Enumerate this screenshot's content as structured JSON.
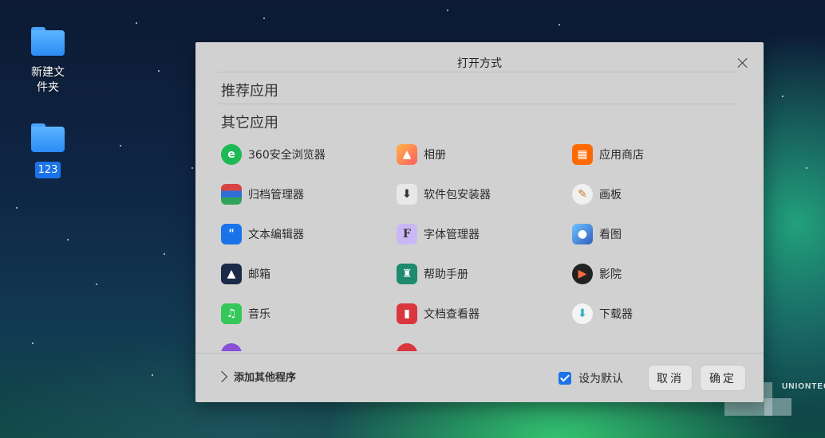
{
  "desktop": {
    "items": [
      {
        "icon": "folder-icon",
        "label_lines": [
          "新建文",
          "件夹"
        ]
      },
      {
        "icon": "folder-icon",
        "label": "123"
      }
    ],
    "watermark": "UNIONTEC"
  },
  "dialog": {
    "title": "打开方式",
    "recommended_label": "推荐应用",
    "other_label": "其它应用",
    "apps": [
      {
        "label": "360安全浏览器",
        "icon": "browser-icon",
        "color": "#1db954"
      },
      {
        "label": "相册",
        "icon": "album-icon",
        "color": "#ff8a3d"
      },
      {
        "label": "应用商店",
        "icon": "store-icon",
        "color": "#ff6a00"
      },
      {
        "label": "归档管理器",
        "icon": "archive-icon",
        "color": "#d94242"
      },
      {
        "label": "软件包安装器",
        "icon": "package-icon",
        "color": "#e8e8e8"
      },
      {
        "label": "画板",
        "icon": "paint-icon",
        "color": "#f0f0f0"
      },
      {
        "label": "文本编辑器",
        "icon": "text-editor-icon",
        "color": "#1a73e8"
      },
      {
        "label": "字体管理器",
        "icon": "font-icon",
        "color": "#c9b8f5"
      },
      {
        "label": "看图",
        "icon": "image-viewer-icon",
        "color": "#2f5fbd"
      },
      {
        "label": "邮箱",
        "icon": "mail-icon",
        "color": "#1b2a48"
      },
      {
        "label": "帮助手册",
        "icon": "manual-icon",
        "color": "#1e8a6e"
      },
      {
        "label": "影院",
        "icon": "movie-icon",
        "color": "#222222"
      },
      {
        "label": "音乐",
        "icon": "music-icon",
        "color": "#35c759"
      },
      {
        "label": "文档查看器",
        "icon": "document-viewer-icon",
        "color": "#d9363e"
      },
      {
        "label": "下载器",
        "icon": "downloader-icon",
        "color": "#f4f4f4"
      },
      {
        "label": "",
        "icon": "app-icon",
        "color": "#8a4fd8"
      },
      {
        "label": "",
        "icon": "app-icon",
        "color": "#d9363e"
      }
    ],
    "add_more_label": "添加其他程序",
    "set_default_label": "设为默认",
    "set_default_checked": true,
    "cancel_label": "取消",
    "confirm_label": "确定"
  }
}
